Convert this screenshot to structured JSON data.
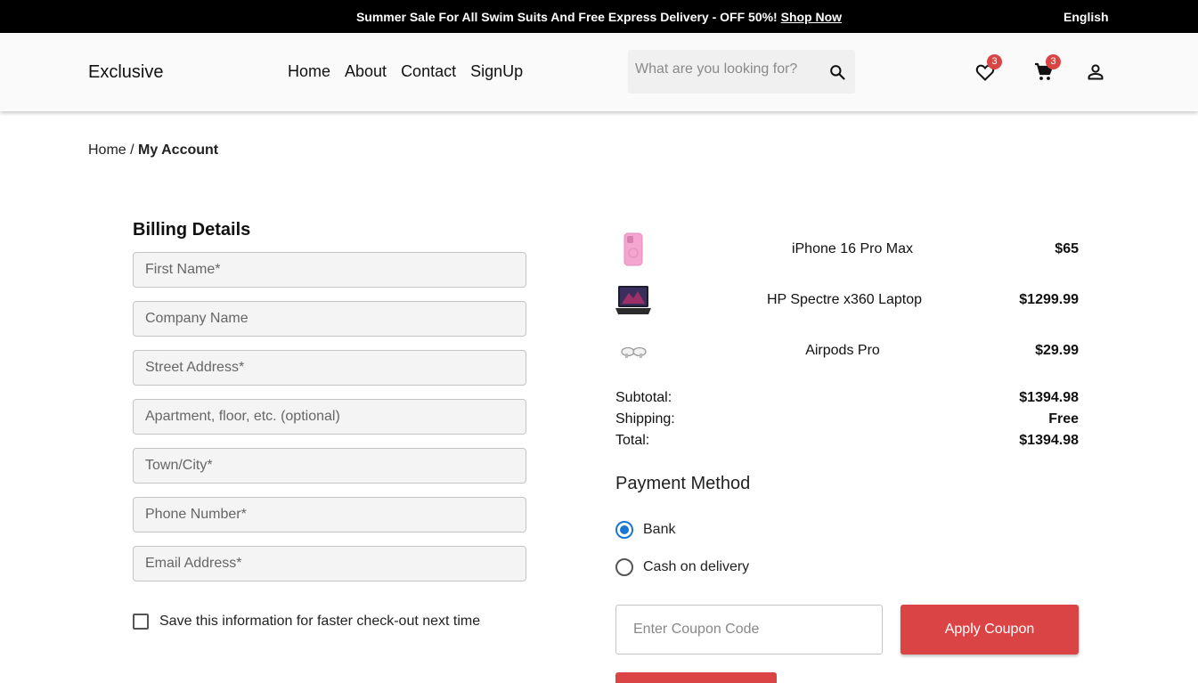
{
  "topbar": {
    "promo": "Summer Sale For All Swim Suits And Free Express Delivery - OFF 50%!",
    "shop_now": "Shop Now",
    "language": "English"
  },
  "header": {
    "logo": "Exclusive",
    "nav": [
      "Home",
      "About",
      "Contact",
      "SignUp"
    ],
    "search_placeholder": "What are you looking for?",
    "wishlist_count": "3",
    "cart_count": "3"
  },
  "breadcrumb": {
    "home": "Home",
    "separator": "/",
    "current": "My Account"
  },
  "billing": {
    "title": "Billing Details",
    "fields": [
      "First Name*",
      "Company Name",
      "Street Address*",
      "Apartment, floor, etc. (optional)",
      "Town/City*",
      "Phone Number*",
      "Email Address*"
    ],
    "save_label": "Save this information for faster check-out next time"
  },
  "order": {
    "items": [
      {
        "name": "iPhone 16 Pro Max",
        "price": "$65",
        "icon": "phone-icon"
      },
      {
        "name": "HP Spectre x360 Laptop",
        "price": "$1299.99",
        "icon": "laptop-icon"
      },
      {
        "name": "Airpods Pro",
        "price": "$29.99",
        "icon": "earbuds-icon"
      }
    ],
    "subtotal_label": "Subtotal:",
    "subtotal": "$1394.98",
    "shipping_label": "Shipping:",
    "shipping": "Free",
    "total_label": "Total:",
    "total": "$1394.98"
  },
  "payment": {
    "title": "Payment Method",
    "options": [
      "Bank",
      "Cash on delivery"
    ],
    "selected": "Bank"
  },
  "coupon": {
    "placeholder": "Enter Coupon Code",
    "apply_label": "Apply Coupon"
  },
  "colors": {
    "accent": "#db4444",
    "radio": "#1976d2"
  }
}
